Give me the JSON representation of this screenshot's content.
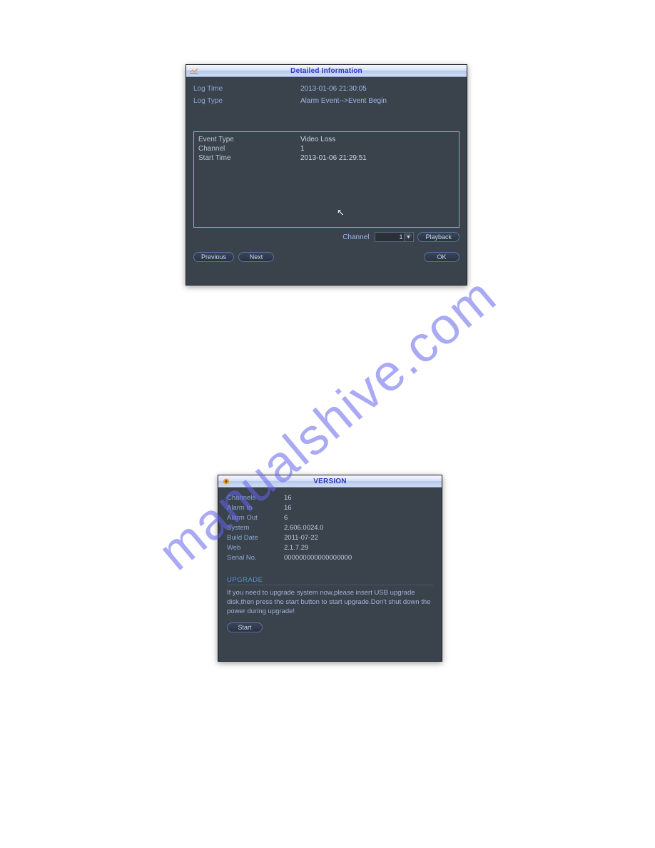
{
  "watermark": "manualshive.com",
  "dialog1": {
    "title": "Detailed Information",
    "logTime": {
      "label": "Log Time",
      "value": "2013-01-06 21:30:05"
    },
    "logType": {
      "label": "Log Type",
      "value": "Alarm Event-->Event Begin"
    },
    "event": {
      "eventType": {
        "label": "Event Type",
        "value": "Video Loss"
      },
      "channel": {
        "label": "Channel",
        "value": "1"
      },
      "startTime": {
        "label": "Start Time",
        "value": "2013-01-06 21:29:51"
      }
    },
    "channelLabel": "Channel",
    "channelValue": "1",
    "playback": "Playback",
    "previous": "Previous",
    "next": "Next",
    "ok": "OK"
  },
  "dialog2": {
    "title": "VERSION",
    "rows": {
      "channels": {
        "label": "Channels",
        "value": "16"
      },
      "alarmIn": {
        "label": "Alarm In",
        "value": "16"
      },
      "alarmOut": {
        "label": "Alarm Out",
        "value": "6"
      },
      "system": {
        "label": "System",
        "value": "2.606.0024.0"
      },
      "buildDate": {
        "label": "Build Date",
        "value": "2011-07-22"
      },
      "web": {
        "label": "Web",
        "value": "2.1.7.29"
      },
      "serial": {
        "label": "Serial No.",
        "value": "000000000000000000"
      }
    },
    "upgradeHeading": "UPGRADE",
    "upgradeText": "If you need to upgrade system now,please insert USB upgrade disk,then press the start button to start upgrade.Don't shut down the power during upgrade!",
    "start": "Start"
  }
}
